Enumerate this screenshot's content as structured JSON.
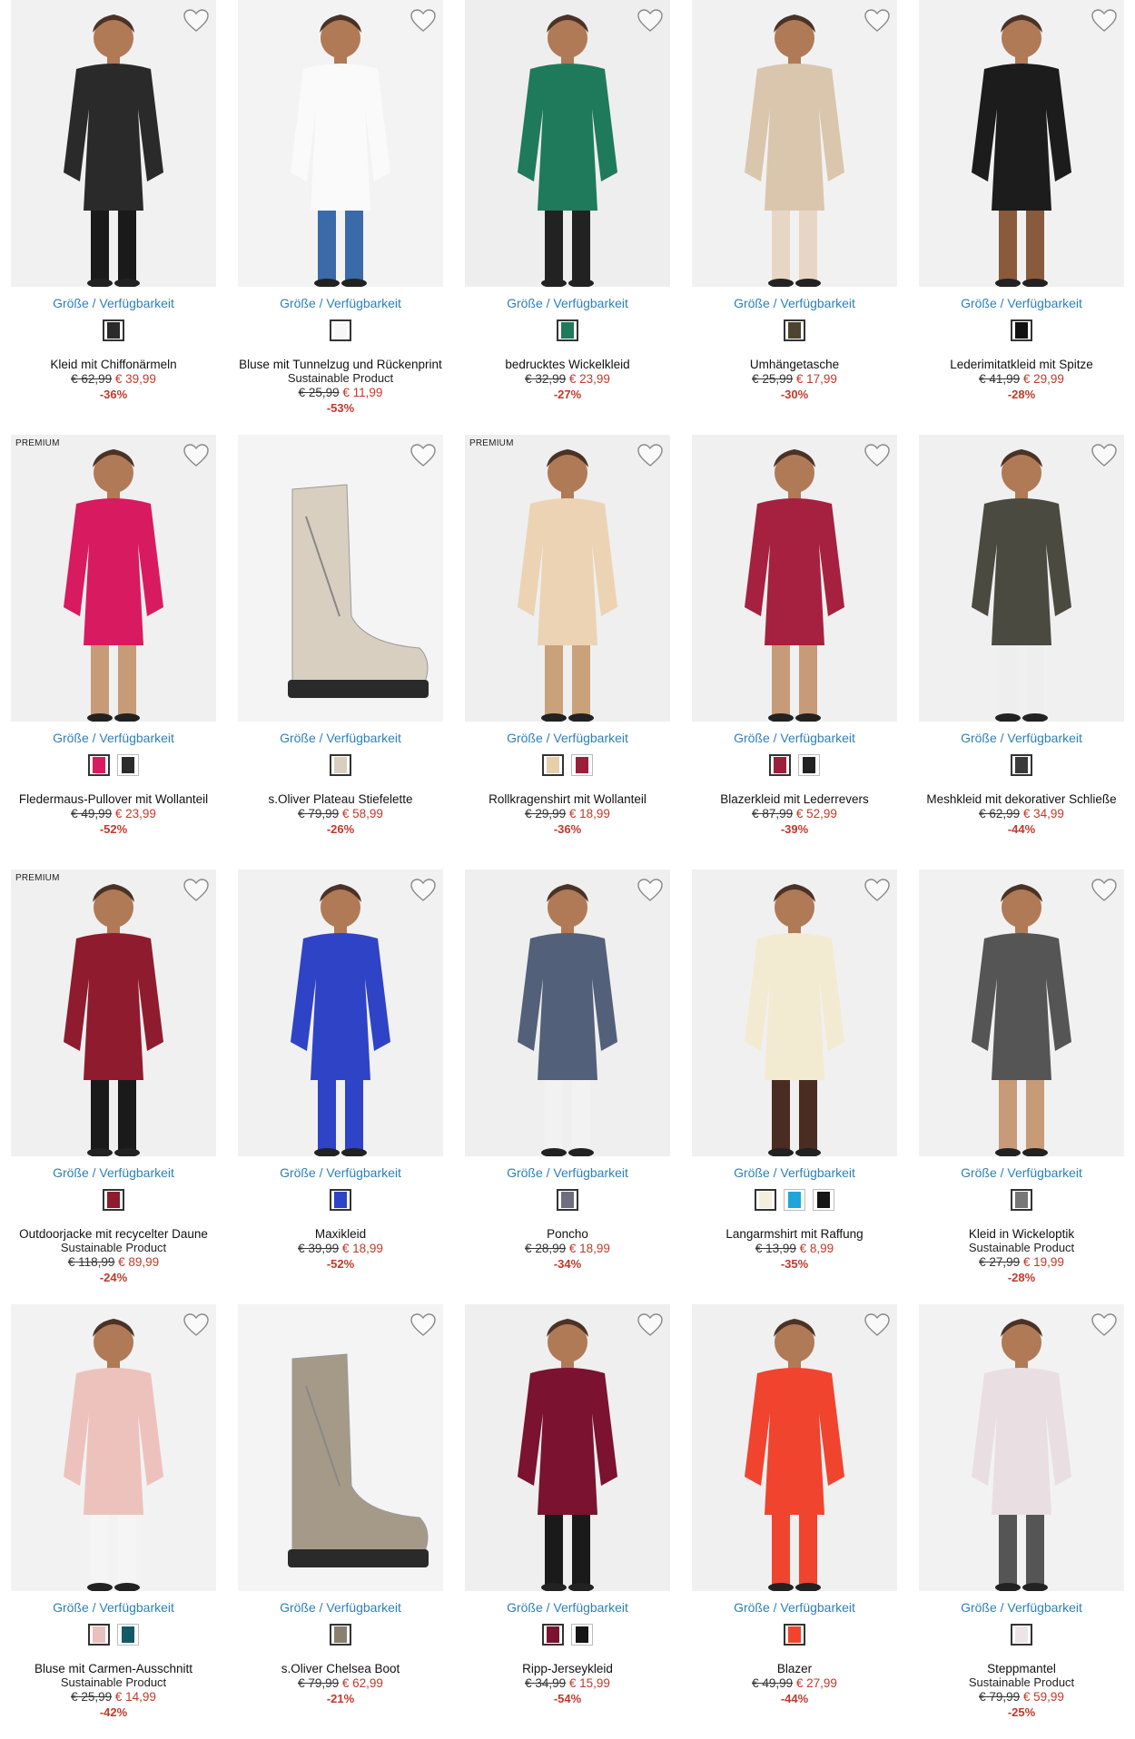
{
  "labels": {
    "size_link": "Größe / Verfügbarkeit",
    "premium": "PREMIUM",
    "sustainable": "Sustainable Product"
  },
  "colors": {
    "link": "#2e7fb8",
    "sale": "#c0392b"
  },
  "products": [
    {
      "name": "Kleid mit Chiffonärmeln",
      "old": "€ 62,99",
      "new": "€ 39,99",
      "disc": "-36%",
      "premium": false,
      "sustainable": false,
      "swatches": [
        "#2b2b2b"
      ],
      "bg": "#f1f1f1",
      "body": "#2a2a2a",
      "legs": "#1a1a1a"
    },
    {
      "name": "Bluse mit Tunnelzug und Rückenprint",
      "old": "€ 25,99",
      "new": "€ 11,99",
      "disc": "-53%",
      "premium": false,
      "sustainable": true,
      "swatches": [
        "#f7f7f7"
      ],
      "bg": "#f3f3f3",
      "body": "#fafafa",
      "legs": "#3b6aa8"
    },
    {
      "name": "bedrucktes Wickelkleid",
      "old": "€ 32,99",
      "new": "€ 23,99",
      "disc": "-27%",
      "premium": false,
      "sustainable": false,
      "swatches": [
        "#1f7a5c"
      ],
      "bg": "#eeeeee",
      "body": "#1f7a5c",
      "legs": "#222"
    },
    {
      "name": "Umhängetasche",
      "old": "€ 25,99",
      "new": "€ 17,99",
      "disc": "-30%",
      "premium": false,
      "sustainable": false,
      "swatches": [
        "#4d4430"
      ],
      "bg": "#f1f1f1",
      "body": "#d9c6ad",
      "legs": "#e8d6c4"
    },
    {
      "name": "Lederimitatkleid mit Spitze",
      "old": "€ 41,99",
      "new": "€ 29,99",
      "disc": "-28%",
      "premium": false,
      "sustainable": false,
      "swatches": [
        "#111111"
      ],
      "bg": "#f1f1f1",
      "body": "#1c1c1c",
      "legs": "#8a5a3c"
    },
    {
      "name": "Fledermaus-Pullover mit Wollanteil",
      "old": "€ 49,99",
      "new": "€ 23,99",
      "disc": "-52%",
      "premium": true,
      "sustainable": false,
      "swatches": [
        "#d81b60",
        "#2b2b2b"
      ],
      "bg": "#f0f0f0",
      "body": "#d81b60",
      "legs": "#c79b77"
    },
    {
      "name": "s.Oliver Plateau Stiefelette",
      "old": "€ 79,99",
      "new": "€ 58,99",
      "disc": "-26%",
      "premium": false,
      "sustainable": false,
      "swatches": [
        "#d9cfc1"
      ],
      "bg": "#f4f4f4",
      "body": "#d9cfc1",
      "legs": "#d9cfc1",
      "boot": true
    },
    {
      "name": "Rollkragenshirt mit Wollanteil",
      "old": "€ 29,99",
      "new": "€ 18,99",
      "disc": "-36%",
      "premium": true,
      "sustainable": false,
      "swatches": [
        "#e7cfae",
        "#9b1f3a"
      ],
      "bg": "#efefef",
      "body": "#ecd3b3",
      "legs": "#c9a27a"
    },
    {
      "name": "Blazerkleid mit Lederrevers",
      "old": "€ 87,99",
      "new": "€ 52,99",
      "disc": "-39%",
      "premium": false,
      "sustainable": false,
      "swatches": [
        "#9b1f3a",
        "#222222"
      ],
      "bg": "#f0f0f0",
      "body": "#a6213f",
      "legs": "#c79b77"
    },
    {
      "name": "Meshkleid mit dekorativer Schließe",
      "old": "€ 62,99",
      "new": "€ 34,99",
      "disc": "-44%",
      "premium": false,
      "sustainable": false,
      "swatches": [
        "#3a3a3a"
      ],
      "bg": "#f0f0f0",
      "body": "#4a4a40",
      "legs": "#eee"
    },
    {
      "name": "Outdoorjacke mit recycelter Daune",
      "old": "€ 118,99",
      "new": "€ 89,99",
      "disc": "-24%",
      "premium": true,
      "sustainable": true,
      "swatches": [
        "#8e1c2e"
      ],
      "bg": "#f0f0f0",
      "body": "#8e1c2e",
      "legs": "#1a1a1a"
    },
    {
      "name": "Maxikleid",
      "old": "€ 39,99",
      "new": "€ 18,99",
      "disc": "-52%",
      "premium": false,
      "sustainable": false,
      "swatches": [
        "#2f43c7"
      ],
      "bg": "#f1f1f1",
      "body": "#2f43c7",
      "legs": "#2f43c7"
    },
    {
      "name": "Poncho",
      "old": "€ 28,99",
      "new": "€ 18,99",
      "disc": "-34%",
      "premium": false,
      "sustainable": false,
      "swatches": [
        "#6e6e80"
      ],
      "bg": "#efefef",
      "body": "#53607a",
      "legs": "#f2f2f2"
    },
    {
      "name": "Langarmshirt mit Raffung",
      "old": "€ 13,99",
      "new": "€ 8,99",
      "disc": "-35%",
      "premium": false,
      "sustainable": false,
      "swatches": [
        "#f4efdc",
        "#1fa5d8",
        "#151515"
      ],
      "bg": "#f0f0f0",
      "body": "#f3ead2",
      "legs": "#4b2c22"
    },
    {
      "name": "Kleid in Wickeloptik",
      "old": "€ 27,99",
      "new": "€ 19,99",
      "disc": "-28%",
      "premium": false,
      "sustainable": true,
      "swatches": [
        "#777777"
      ],
      "bg": "#f1f1f1",
      "body": "#555555",
      "legs": "#c79b77"
    },
    {
      "name": "Bluse mit Carmen-Ausschnitt",
      "old": "€ 25,99",
      "new": "€ 14,99",
      "disc": "-42%",
      "premium": false,
      "sustainable": true,
      "swatches": [
        "#e8c0c0",
        "#145a66"
      ],
      "bg": "#f2f2f2",
      "body": "#edc2bd",
      "legs": "#f5f5f5"
    },
    {
      "name": "s.Oliver Chelsea Boot",
      "old": "€ 79,99",
      "new": "€ 62,99",
      "disc": "-21%",
      "premium": false,
      "sustainable": false,
      "swatches": [
        "#8a8070"
      ],
      "bg": "#f4f4f4",
      "body": "#a59a88",
      "legs": "#a59a88",
      "boot": true
    },
    {
      "name": "Ripp-Jerseykleid",
      "old": "€ 34,99",
      "new": "€ 15,99",
      "disc": "-54%",
      "premium": false,
      "sustainable": false,
      "swatches": [
        "#7a1230",
        "#151515"
      ],
      "bg": "#efefef",
      "body": "#7a1230",
      "legs": "#1a1a1a"
    },
    {
      "name": "Blazer",
      "old": "€ 49,99",
      "new": "€ 27,99",
      "disc": "-44%",
      "premium": false,
      "sustainable": false,
      "swatches": [
        "#f0442f"
      ],
      "bg": "#f0f0f0",
      "body": "#f0442f",
      "legs": "#f0442f"
    },
    {
      "name": "Steppmantel",
      "old": "€ 79,99",
      "new": "€ 59,99",
      "disc": "-25%",
      "premium": false,
      "sustainable": true,
      "swatches": [
        "#ece4e8"
      ],
      "bg": "#f2f2f2",
      "body": "#e9dfe3",
      "legs": "#555"
    }
  ]
}
